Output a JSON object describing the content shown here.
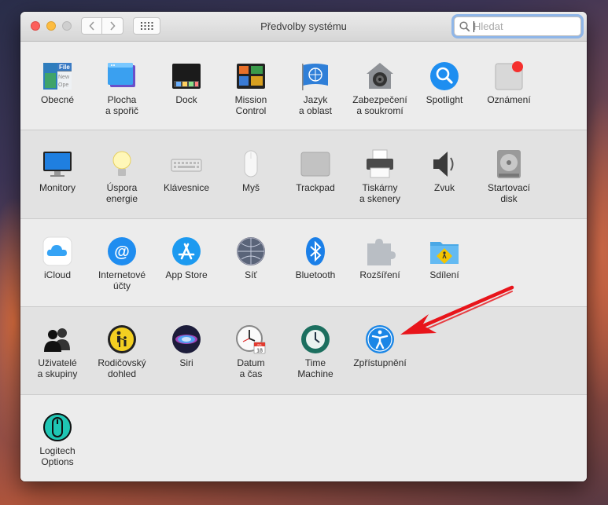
{
  "window": {
    "title": "Předvolby systému",
    "search": {
      "placeholder": "Hledat",
      "value": ""
    }
  },
  "sections": [
    {
      "items": [
        {
          "label": "Obecné",
          "icon": "general-icon"
        },
        {
          "label": "Plocha\na spořič",
          "icon": "desktop-screensaver-icon"
        },
        {
          "label": "Dock",
          "icon": "dock-icon"
        },
        {
          "label": "Mission\nControl",
          "icon": "mission-control-icon"
        },
        {
          "label": "Jazyk\na oblast",
          "icon": "language-region-icon"
        },
        {
          "label": "Zabezpečení\na soukromí",
          "icon": "security-icon"
        },
        {
          "label": "Spotlight",
          "icon": "spotlight-icon"
        },
        {
          "label": "Oznámení",
          "icon": "notifications-icon"
        }
      ]
    },
    {
      "items": [
        {
          "label": "Monitory",
          "icon": "displays-icon"
        },
        {
          "label": "Úspora\nenergie",
          "icon": "energy-saver-icon"
        },
        {
          "label": "Klávesnice",
          "icon": "keyboard-icon"
        },
        {
          "label": "Myš",
          "icon": "mouse-icon"
        },
        {
          "label": "Trackpad",
          "icon": "trackpad-icon"
        },
        {
          "label": "Tiskárny\na skenery",
          "icon": "printers-icon"
        },
        {
          "label": "Zvuk",
          "icon": "sound-icon"
        },
        {
          "label": "Startovací\ndisk",
          "icon": "startup-disk-icon"
        }
      ]
    },
    {
      "items": [
        {
          "label": "iCloud",
          "icon": "icloud-icon"
        },
        {
          "label": "Internetové\núčty",
          "icon": "internet-accounts-icon"
        },
        {
          "label": "App Store",
          "icon": "app-store-icon"
        },
        {
          "label": "Síť",
          "icon": "network-icon"
        },
        {
          "label": "Bluetooth",
          "icon": "bluetooth-icon"
        },
        {
          "label": "Rozšíření",
          "icon": "extensions-icon"
        },
        {
          "label": "Sdílení",
          "icon": "sharing-icon"
        }
      ]
    },
    {
      "items": [
        {
          "label": "Uživatelé\na skupiny",
          "icon": "users-groups-icon"
        },
        {
          "label": "Rodičovský\ndohled",
          "icon": "parental-controls-icon"
        },
        {
          "label": "Siri",
          "icon": "siri-icon"
        },
        {
          "label": "Datum\na čas",
          "icon": "date-time-icon",
          "calendar": {
            "month": "JUL",
            "day": "18"
          }
        },
        {
          "label": "Time\nMachine",
          "icon": "time-machine-icon"
        },
        {
          "label": "Zpřístupnění",
          "icon": "accessibility-icon"
        }
      ]
    },
    {
      "items": [
        {
          "label": "Logitech Options",
          "icon": "logitech-options-icon"
        }
      ]
    }
  ],
  "colors": {
    "annotation_arrow": "#e8151b",
    "search_focus": "#8fb6e8"
  }
}
